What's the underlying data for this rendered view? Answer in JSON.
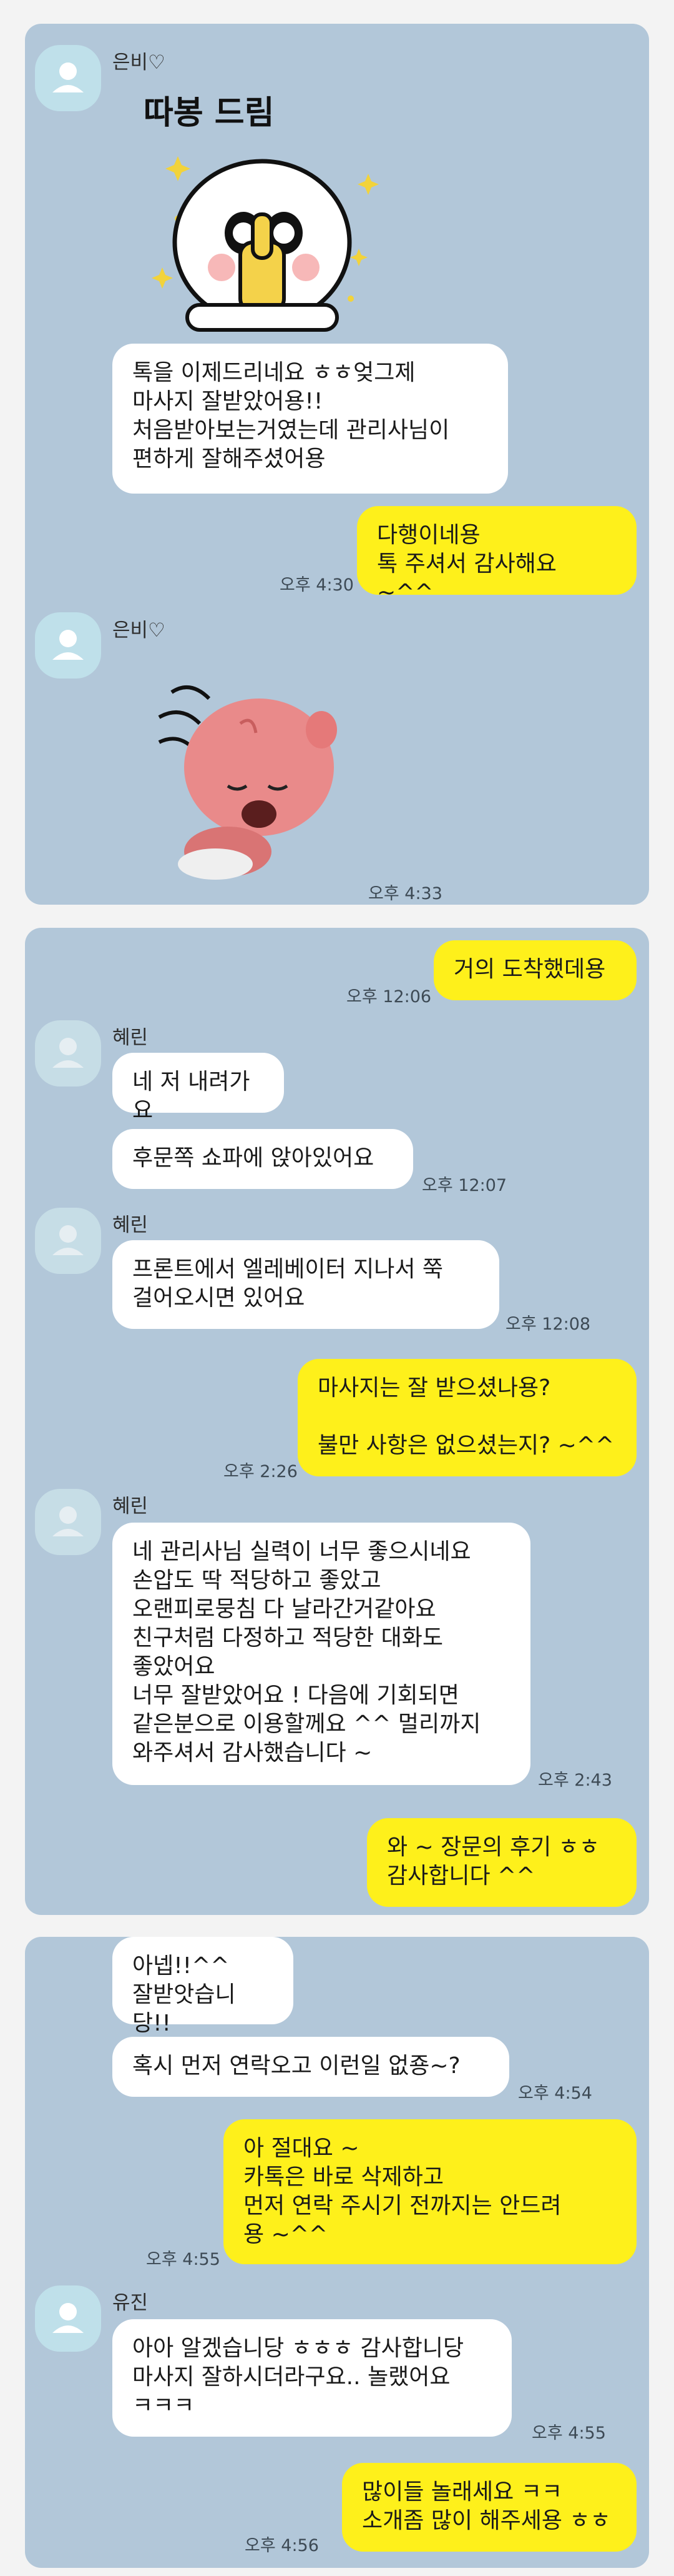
{
  "panel1": {
    "sender1": "은비♡",
    "sticker1_text": "따봉 드림",
    "msg1": "톡을 이제드리네요 ㅎㅎ엊그제\n마사지 잘받았어용!!\n처음받아보는거였는데 관리사님이\n편하게 잘해주셨어용",
    "reply1": "다행이네용\n톡 주셔서 감사해요 ~^^",
    "reply1_time": "오후 4:30",
    "sender2": "은비♡",
    "sticker2_time": "오후 4:33"
  },
  "panel2": {
    "out1": "거의 도착했데용",
    "out1_time": "오후 12:06",
    "sender1": "혜린",
    "in1": "네 저 내려가요",
    "in2": "후문쪽 쇼파에 앉아있어요",
    "in2_time": "오후 12:07",
    "sender2": "혜린",
    "in3": "프론트에서 엘레베이터 지나서 쭉\n걸어오시면 있어요",
    "in3_time": "오후 12:08",
    "out2": "마사지는 잘 받으셨나용?\n\n불만 사항은 없으셨는지? ~^^",
    "out2_time": "오후 2:26",
    "sender3": "혜린",
    "in4": "네 관리사님 실력이 너무 좋으시네요\n손압도 딱 적당하고 좋았고\n오랜피로뭉침 다 날라간거같아요\n친구처럼 다정하고 적당한 대화도\n좋았어요\n너무 잘받았어요 ! 다음에 기회되면\n같은분으로 이용할께요 ^^ 멀리까지\n와주셔서 감사했습니다 ~",
    "in4_time": "오후 2:43",
    "out3": "와 ~ 장문의 후기 ㅎㅎ\n감사합니다 ^^"
  },
  "panel3": {
    "in1": "아넵!!^^\n잘받앗습니당!!",
    "in2": "혹시 먼저 연락오고 이런일 없죵~?",
    "in2_time": "오후 4:54",
    "out1": "아 절대요 ~\n카톡은 바로 삭제하고\n먼저 연락 주시기 전까지는 안드려\n용 ~^^",
    "out1_time": "오후 4:55",
    "sender1": "유진",
    "in3": "아아 알겠습니당 ㅎㅎㅎ 감사합니당\n마사지 잘하시더라구요.. 놀랬어요\nㅋㅋㅋ",
    "in3_time": "오후 4:55",
    "out2": "많이들 놀래세요 ㅋㅋ\n소개좀 많이 해주세용 ㅎㅎ",
    "out2_time": "오후 4:56"
  }
}
